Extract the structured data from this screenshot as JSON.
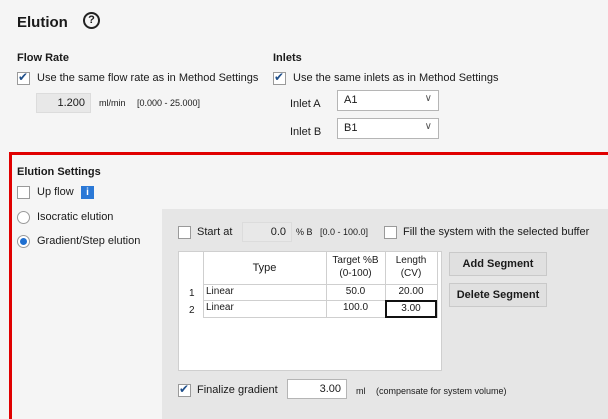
{
  "title": "Elution",
  "flow_rate": {
    "heading": "Flow Rate",
    "same_label": "Use the same flow rate as in Method Settings",
    "same_checked": true,
    "value": "1.200",
    "unit": "ml/min",
    "range": "[0.000 - 25.000]"
  },
  "inlets": {
    "heading": "Inlets",
    "same_label": "Use the same inlets as in Method Settings",
    "same_checked": true,
    "inlet_a_label": "Inlet A",
    "inlet_a_value": "A1",
    "inlet_b_label": "Inlet B",
    "inlet_b_value": "B1"
  },
  "elution_settings": {
    "heading": "Elution Settings",
    "up_flow_label": "Up flow",
    "up_flow_checked": false,
    "info_glyph": "i",
    "isocratic_label": "Isocratic elution",
    "gradient_label": "Gradient/Step elution",
    "gradient_selected": true
  },
  "gradient": {
    "start_at_label": "Start at",
    "start_at_value": "0.0",
    "start_at_unit": "% B",
    "start_at_range": "[0.0 - 100.0]",
    "fill_label": "Fill the system with the selected buffer",
    "columns": [
      "Type",
      "Target %B\n(0-100)",
      "Length\n(CV)"
    ],
    "col_type": "Type",
    "col_target_1": "Target %B",
    "col_target_2": "(0-100)",
    "col_length_1": "Length",
    "col_length_2": "(CV)",
    "rows": [
      {
        "index": "1",
        "type": "Linear",
        "target": "50.0",
        "length": "20.00"
      },
      {
        "index": "2",
        "type": "Linear",
        "target": "100.0",
        "length": "3.00"
      }
    ],
    "add_segment": "Add Segment",
    "delete_segment": "Delete Segment",
    "finalize_label": "Finalize gradient",
    "finalize_checked": true,
    "finalize_value": "3.00",
    "finalize_unit": "ml",
    "finalize_note": "(compensate for system volume)"
  }
}
